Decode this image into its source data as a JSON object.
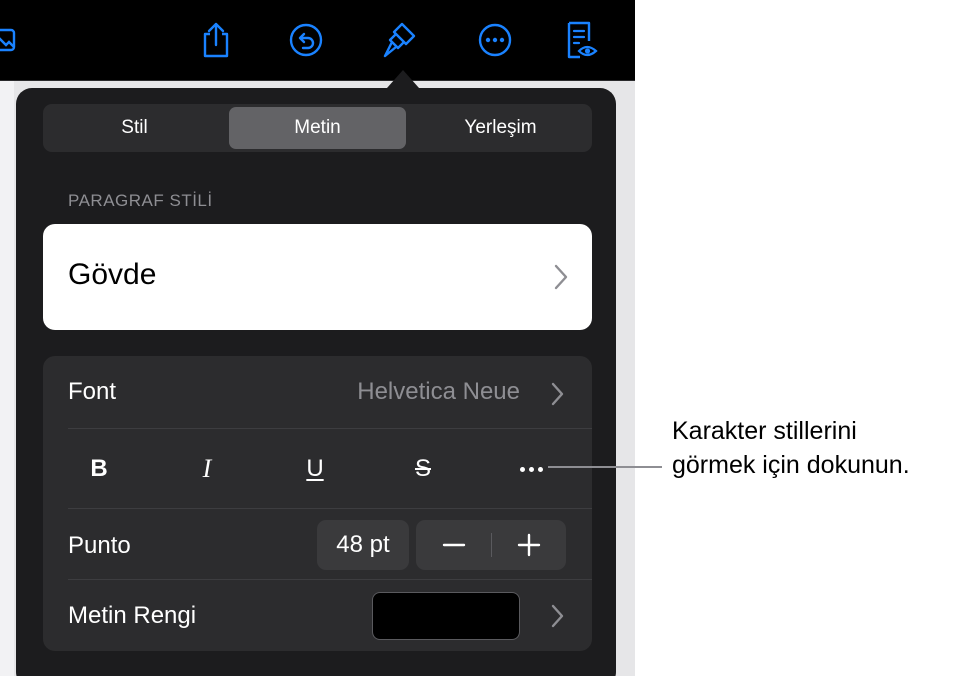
{
  "toolbar": {
    "icons": [
      "photo-icon",
      "share-icon",
      "undo-icon",
      "format-brush-icon",
      "more-icon",
      "reading-view-icon"
    ],
    "accent_color": "#1a82ff"
  },
  "tabs": [
    {
      "label": "Stil",
      "selected": false
    },
    {
      "label": "Metin",
      "selected": true
    },
    {
      "label": "Yerleşim",
      "selected": false
    }
  ],
  "paragraph_style": {
    "section_label": "PARAGRAF STİLİ",
    "value": "Gövde"
  },
  "font_row": {
    "label": "Font",
    "value": "Helvetica Neue"
  },
  "style_buttons": {
    "bold": "B",
    "italic": "I",
    "underline": "U",
    "strike": "S"
  },
  "size_row": {
    "label": "Punto",
    "value": "48 pt"
  },
  "color_row": {
    "label": "Metin Rengi",
    "swatch_color": "#000000"
  },
  "callout": {
    "line1": "Karakter stillerini",
    "line2": "görmek için dokunun."
  }
}
